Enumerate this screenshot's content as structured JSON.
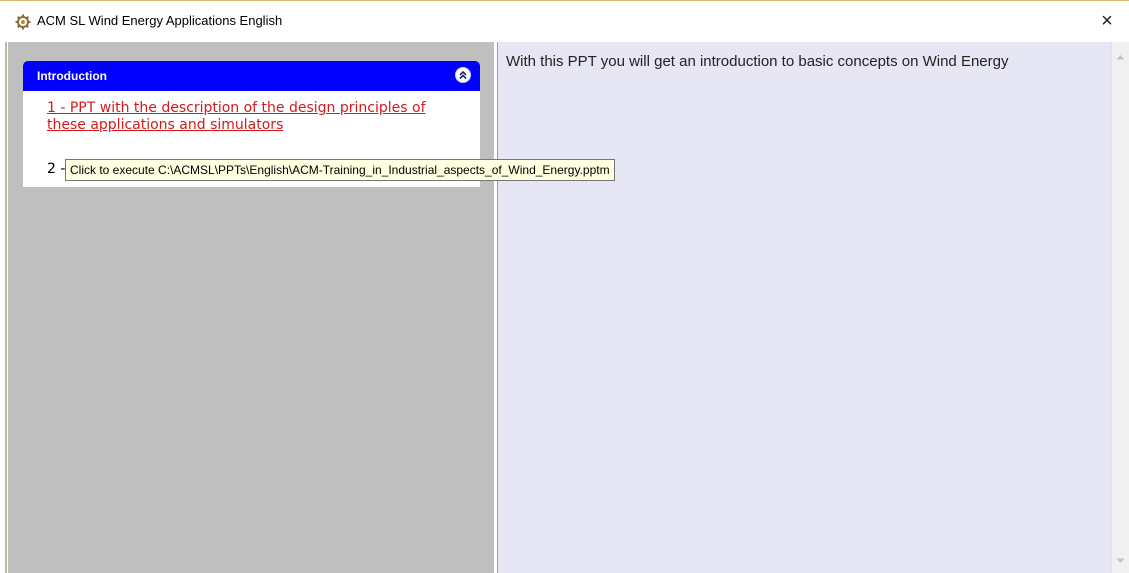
{
  "window": {
    "title": "ACM SL Wind Energy Applications English",
    "app_icon": "wind-turbine-gear-icon",
    "close_glyph": "×"
  },
  "left_panel": {
    "header_title": "Introduction",
    "collapse_icon": "double-chevron-up-icon",
    "items": [
      {
        "label": "1 - PPT with the description of the design principles of these applications and simulators"
      },
      {
        "label": "2 -"
      }
    ]
  },
  "tooltip": {
    "text": "Click to execute C:\\ACMSL\\PPTs\\English\\ACM-Training_in_Industrial_aspects_of_Wind_Energy.pptm"
  },
  "right_panel": {
    "description": "With this PPT you will get an introduction to basic concepts on Wind Energy"
  },
  "colors": {
    "panel_header": "#0000ff",
    "link_red": "#d31a1a",
    "left_background": "#bfbfbf",
    "right_background": "#e6e6f5",
    "tooltip_background": "#ffffe1"
  }
}
